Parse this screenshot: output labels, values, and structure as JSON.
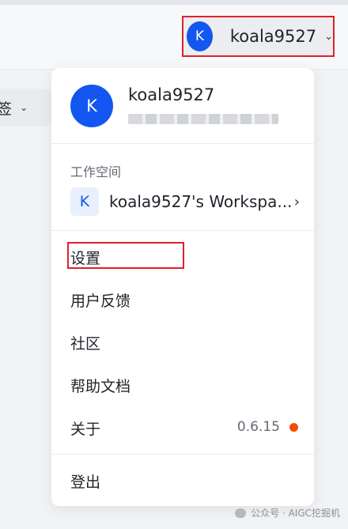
{
  "header": {
    "user": {
      "initial": "K",
      "name": "koala9527",
      "chevron": "⌄"
    }
  },
  "filter": {
    "label": "签",
    "chevron": "⌄"
  },
  "menu": {
    "profile": {
      "initial": "K",
      "name": "koala9527"
    },
    "workspace": {
      "heading": "工作空间",
      "badge": "K",
      "name": "koala9527's Workspa...",
      "chevron": "›"
    },
    "items": {
      "settings": "设置",
      "feedback": "用户反馈",
      "community": "社区",
      "docs": "帮助文档",
      "about": "关于",
      "logout": "登出"
    },
    "version": "0.6.15",
    "accent_color": "#1456f0",
    "dot_color": "#f54a00",
    "highlight_color": "#e0202a"
  },
  "watermark": {
    "text": "公众号 · AIGC挖掘机"
  }
}
